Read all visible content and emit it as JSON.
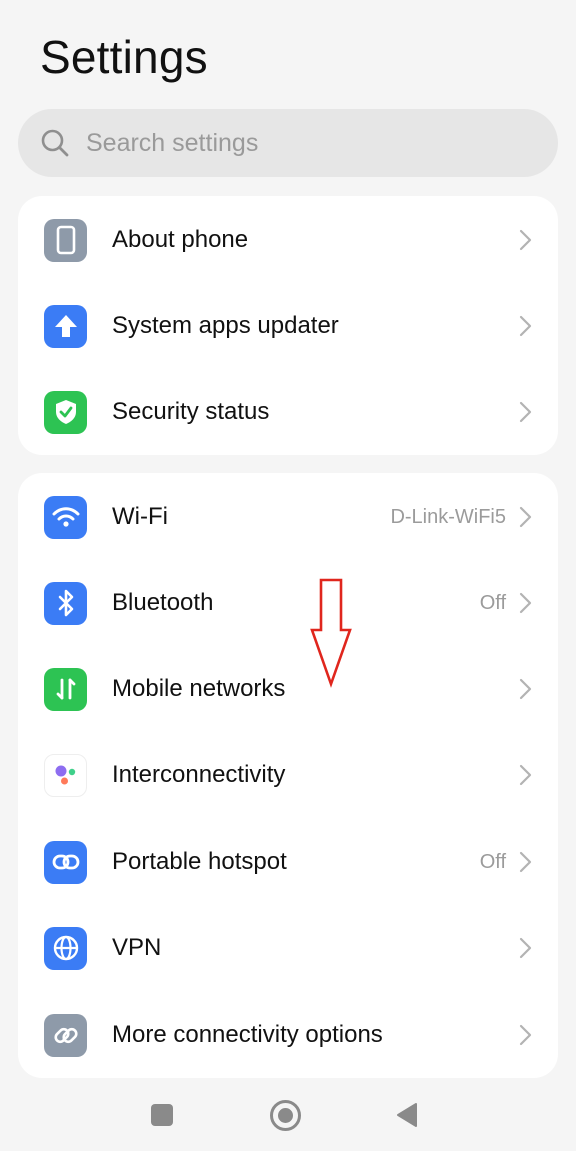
{
  "header": {
    "title": "Settings"
  },
  "search": {
    "placeholder": "Search settings"
  },
  "colors": {
    "blue": "#3b7cf5",
    "green": "#2dc353",
    "gray": "#8e9aa9",
    "arrow": "#e0261d"
  },
  "groups": [
    {
      "items": [
        {
          "label": "About phone",
          "icon": "phone-icon"
        },
        {
          "label": "System apps updater",
          "icon": "up-arrow-icon"
        },
        {
          "label": "Security status",
          "icon": "shield-check-icon"
        }
      ]
    },
    {
      "items": [
        {
          "label": "Wi-Fi",
          "value": "D-Link-WiFi5",
          "icon": "wifi-icon"
        },
        {
          "label": "Bluetooth",
          "value": "Off",
          "icon": "bluetooth-icon"
        },
        {
          "label": "Mobile networks",
          "icon": "mobile-data-icon"
        },
        {
          "label": "Interconnectivity",
          "icon": "interconnectivity-icon"
        },
        {
          "label": "Portable hotspot",
          "value": "Off",
          "icon": "hotspot-icon"
        },
        {
          "label": "VPN",
          "icon": "globe-icon"
        },
        {
          "label": "More connectivity options",
          "icon": "link-icon"
        }
      ]
    }
  ],
  "annotation": {
    "icon": "down-arrow-annotation-icon"
  },
  "navigation": {
    "recents": "recents-square-icon",
    "home": "home-circle-icon",
    "back": "back-triangle-icon"
  }
}
